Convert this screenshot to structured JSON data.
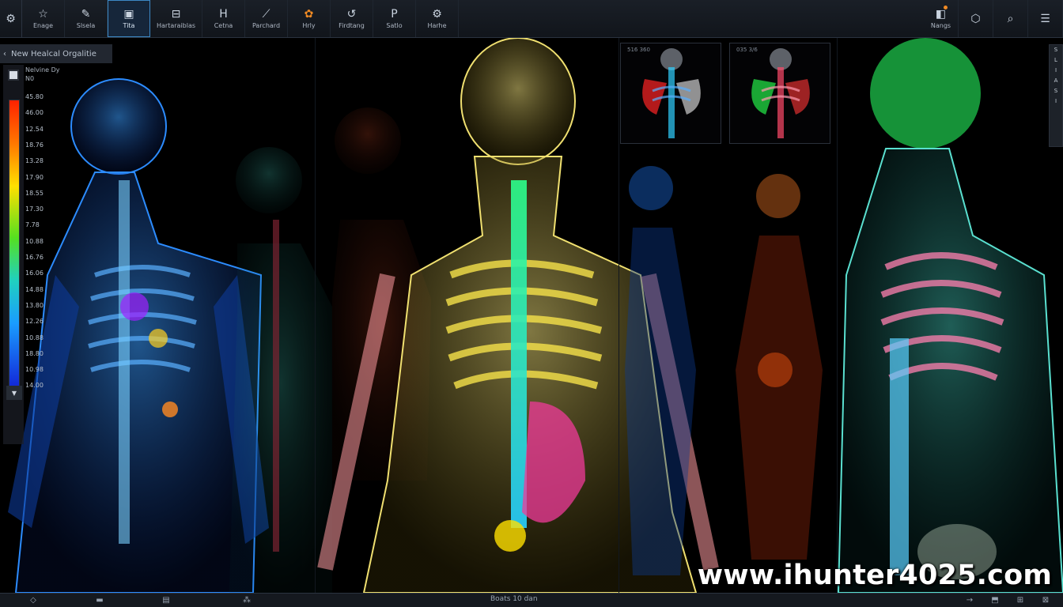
{
  "toolbar": {
    "left_icon": "gear-icon",
    "buttons": [
      {
        "label": "Enage",
        "icon": "☆",
        "icon_name": "star-icon"
      },
      {
        "label": "Slsela",
        "icon": "✎",
        "icon_name": "pencil-icon"
      },
      {
        "label": "Tita",
        "icon": "▣",
        "icon_name": "edit-frame-icon",
        "active": true
      },
      {
        "label": "Hartaraiblas",
        "icon": "⊟",
        "icon_name": "layers-icon"
      },
      {
        "label": "Cetna",
        "icon": "H",
        "icon_name": "h-tool-icon"
      },
      {
        "label": "Parchard",
        "icon": "⟋",
        "icon_name": "brush-icon"
      },
      {
        "label": "Hrly",
        "icon": "✿",
        "icon_name": "flower-icon"
      },
      {
        "label": "Firdtang",
        "icon": "↺",
        "icon_name": "rotate-icon"
      },
      {
        "label": "Satlo",
        "icon": "P",
        "icon_name": "p-tool-icon"
      },
      {
        "label": "Harhe",
        "icon": "⚙",
        "icon_name": "settings-icon"
      }
    ],
    "right": [
      {
        "label": "Nangs",
        "icon": "◧",
        "icon_name": "notification-icon"
      },
      {
        "label": "",
        "icon": "⬡",
        "icon_name": "hexagon-icon"
      },
      {
        "label": "",
        "icon": "⌕",
        "icon_name": "search-icon"
      },
      {
        "label": "",
        "icon": "☰",
        "icon_name": "menu-icon"
      }
    ]
  },
  "panel": {
    "title": "New Healcal Orgalitie",
    "back_icon": "‹",
    "scale_title_line1": "Nelvine Dy",
    "scale_title_line2": "N0",
    "scale_arrow": "▼",
    "ticks": [
      "45.80",
      "46.00",
      "12.54",
      "18.76",
      "13.28",
      "17.90",
      "18.55",
      "17.30",
      "7.78",
      "10.88",
      "16.76",
      "16.06",
      "14.88",
      "13.80",
      "12.26",
      "10.88",
      "18.80",
      "10.98",
      "14.00"
    ]
  },
  "subviews": [
    {
      "label": "516 360"
    },
    {
      "label": "035 3/6"
    }
  ],
  "right_strip": [
    "S",
    "L",
    "I",
    "A",
    "S",
    "I"
  ],
  "watermark": "www.ihunter4025.com",
  "bottombar": {
    "status": "Boats 10 dan",
    "icons": [
      "◇",
      "▬",
      "▤",
      "⁂"
    ],
    "right_icons": [
      "→",
      "⬒",
      "⊞",
      "⊠"
    ]
  },
  "colors": {
    "accent": "#3d89c6",
    "toolbar_bg": "#14181f"
  }
}
